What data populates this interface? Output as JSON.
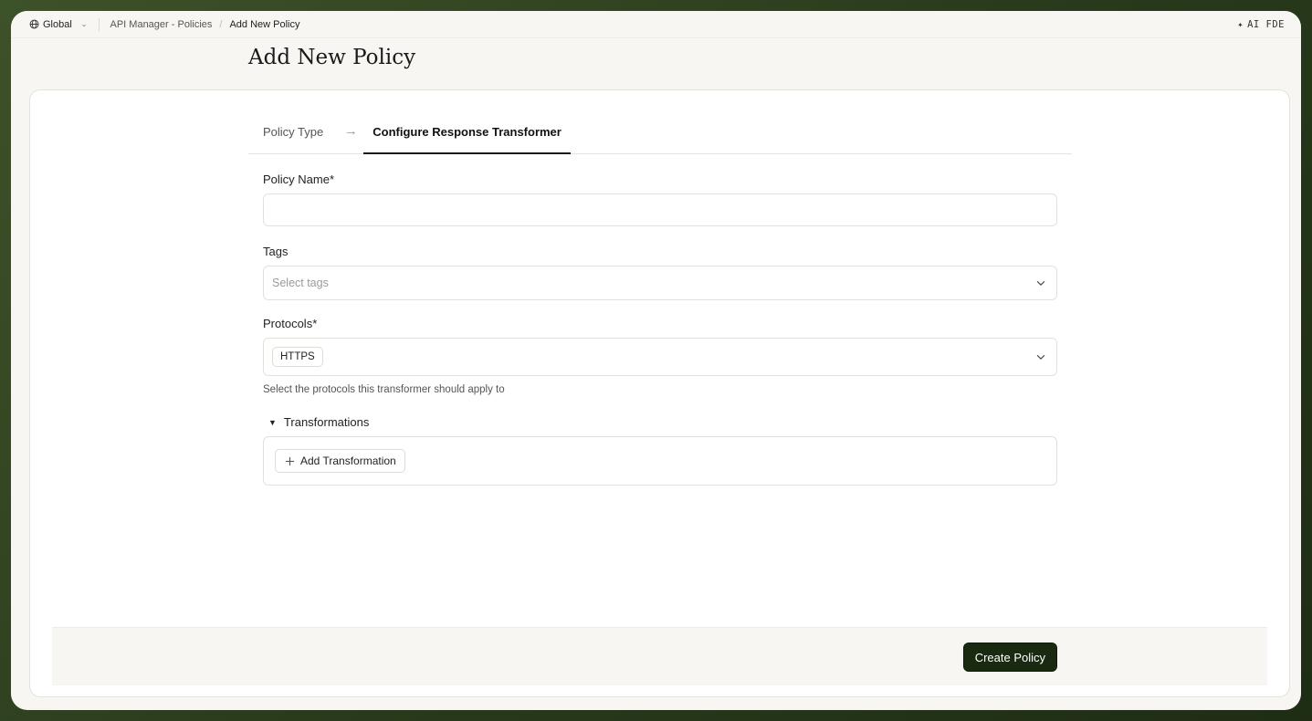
{
  "topbar": {
    "scope_label": "Global",
    "breadcrumb_parent": "API Manager - Policies",
    "breadcrumb_current": "Add New Policy",
    "ai_label": "AI FDE"
  },
  "page": {
    "title": "Add New Policy"
  },
  "tabs": [
    {
      "label": "Policy Type",
      "active": false
    },
    {
      "label": "Configure Response Transformer",
      "active": true
    }
  ],
  "form": {
    "policy_name_label": "Policy Name*",
    "policy_name_value": "",
    "tags_label": "Tags",
    "tags_placeholder": "Select tags",
    "protocols_label": "Protocols*",
    "protocols_selected": [
      "HTTPS"
    ],
    "protocols_hint": "Select the protocols this transformer should apply to",
    "transformations_label": "Transformations",
    "add_transformation_label": "Add Transformation"
  },
  "footer": {
    "create_label": "Create Policy"
  },
  "colors": {
    "primary_button": "#1a2a10",
    "background_outer": "#2f4220"
  }
}
